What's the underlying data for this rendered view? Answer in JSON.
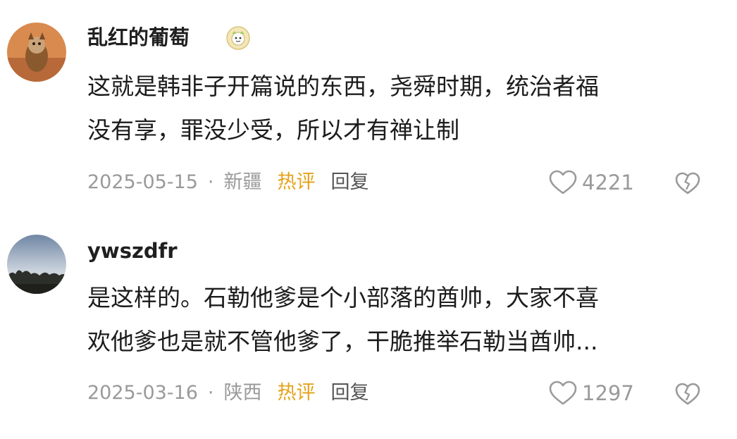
{
  "comments": [
    {
      "username": "乱红的葡萄",
      "badge_icon": "cartoon-badge-icon",
      "text_lines": [
        "这就是韩非子开篇说的东西，尧舜时期，统治者福",
        "没有享，罪没少受，所以才有禅让制"
      ],
      "date": "2025-05-15",
      "separator": "·",
      "location": "新疆",
      "hot_label": "热评",
      "reply_label": "回复",
      "like_count": "4221",
      "colors": {
        "hot": "#e5a21a"
      }
    },
    {
      "username": "ywszdfr",
      "text_lines": [
        "是这样的。石勒他爹是个小部落的酋帅，大家不喜",
        "欢他爹也是就不管他爹了，干脆推举石勒当酋帅..."
      ],
      "date": "2025-03-16",
      "separator": "·",
      "location": "陕西",
      "hot_label": "热评",
      "reply_label": "回复",
      "like_count": "1297",
      "colors": {
        "hot": "#e5a21a"
      }
    }
  ],
  "icons": {
    "like": "heart-outline-icon",
    "dislike": "broken-heart-icon"
  }
}
